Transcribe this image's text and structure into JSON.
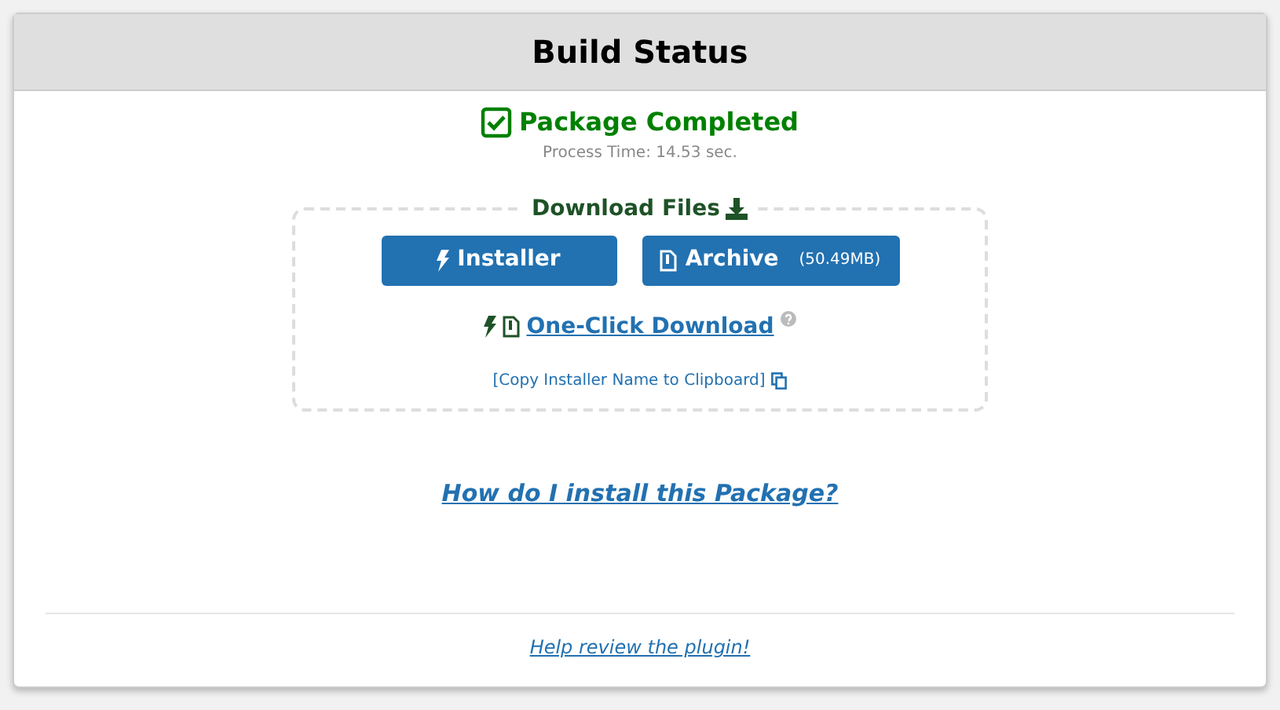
{
  "panel": {
    "title": "Build Status"
  },
  "status": {
    "heading": "Package Completed",
    "process_time": "Process Time: 14.53 sec."
  },
  "download": {
    "legend": "Download Files",
    "buttons": [
      {
        "kind": "installer",
        "label": "Installer"
      },
      {
        "kind": "archive",
        "label": "Archive",
        "size": "(50.49MB)"
      }
    ],
    "one_click": "One-Click Download",
    "copy_link": "[Copy Installer Name to Clipboard]"
  },
  "install_help": "How do I install this Package?",
  "review_link": "Help review the plugin!"
}
